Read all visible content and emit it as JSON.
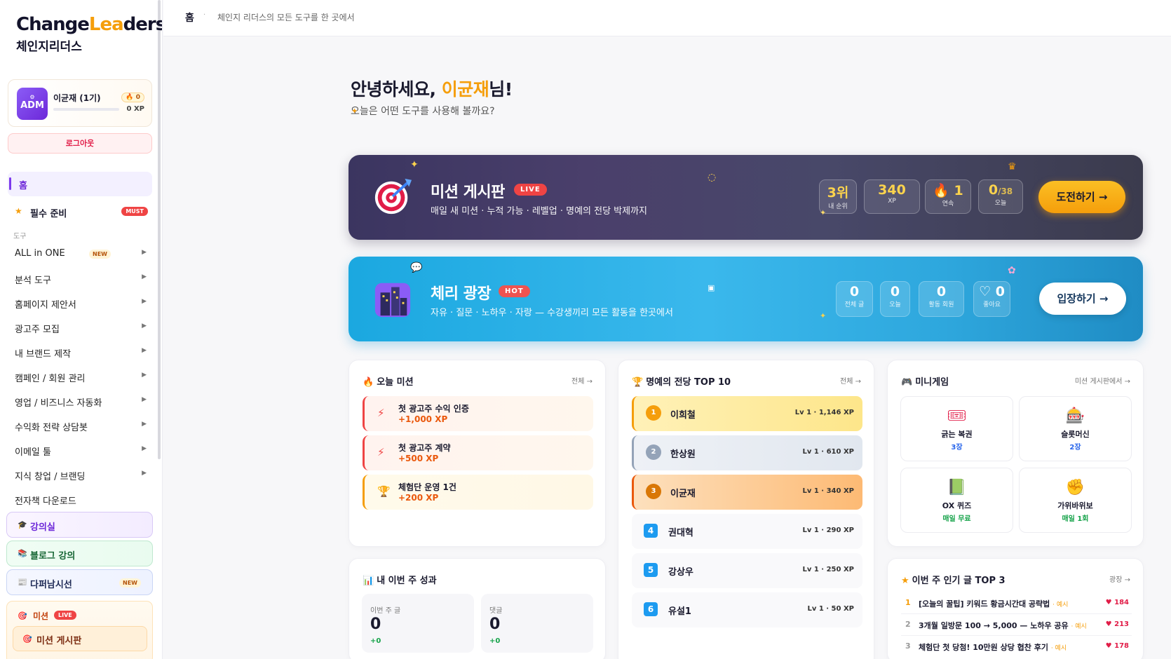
{
  "brand": {
    "logo_en_1": "Change",
    "logo_en_2": "Le",
    "logo_en_3": "a",
    "logo_en_4": "ders",
    "logo_ko": "체인지리더스"
  },
  "profile": {
    "avatar_label": "ADM",
    "name": "이균재 (1기)",
    "fire": "🔥 0",
    "xp": "0 XP",
    "logout": "로그아웃"
  },
  "nav": {
    "home": "홈",
    "must": "필수 준비",
    "must_badge": "MUST",
    "section_tools": "도구",
    "items": [
      {
        "label": "ALL in ONE",
        "badge": "NEW"
      },
      {
        "label": "분석 도구"
      },
      {
        "label": "홈페이지 제안서"
      },
      {
        "label": "광고주 모집"
      },
      {
        "label": "내 브랜드 제작"
      },
      {
        "label": "캠페인 / 회원 관리"
      },
      {
        "label": "영업 / 비즈니스 자동화"
      },
      {
        "label": "수익화 전략 상담봇"
      },
      {
        "label": "이메일 툴"
      },
      {
        "label": "지식 창업 / 브랜딩"
      },
      {
        "label": "전자책 다운로드"
      }
    ],
    "lecture": "강의실",
    "blog": "블로그 강의",
    "news": "다퍼남시선",
    "news_badge": "NEW",
    "mission": "미션",
    "mission_badge": "LIVE",
    "mission_board": "미션 게시판"
  },
  "breadcrumb": {
    "home": "홈",
    "sub": "체인지 리더스의 모든 도구를 한 곳에서"
  },
  "greeting": {
    "prefix": "안녕하세요, ",
    "name": "이균재",
    "suffix": "님!",
    "sub": "오늘은 어떤 도구를 사용해 볼까요?"
  },
  "mission_banner": {
    "title": "미션 게시판",
    "badge": "LIVE",
    "desc": "매일 새 미션 · 누적 가능 · 레벨업 · 명예의 전당 박제까지",
    "stats": [
      {
        "value": "3위",
        "key": "내 순위"
      },
      {
        "value": "340",
        "key": "XP"
      },
      {
        "value": "🔥 1",
        "key": "연속"
      },
      {
        "value": "0",
        "suffix": "/38",
        "key": "오늘"
      }
    ],
    "cta": "도전하기 →"
  },
  "plaza_banner": {
    "title": "체리 광장",
    "badge": "HOT",
    "desc": "자유 · 질문 · 노하우 · 자랑 — 수강생끼리 모든 활동을 한곳에서",
    "stats": [
      {
        "value": "0",
        "key": "전체 글"
      },
      {
        "value": "0",
        "key": "오늘"
      },
      {
        "value": "0",
        "key": "활동 회원"
      },
      {
        "value": "♡ 0",
        "key": "좋아요"
      }
    ],
    "cta": "입장하기 →"
  },
  "today_missions": {
    "title": "오늘 미션",
    "link": "전체 →",
    "items": [
      {
        "title": "첫 광고주 수익 인증",
        "xp": "+1,000 XP"
      },
      {
        "title": "첫 광고주 계약",
        "xp": "+500 XP"
      },
      {
        "title": "체험단 운영 1건",
        "xp": "+200 XP"
      }
    ]
  },
  "hall_of_fame": {
    "title": "명예의 전당 TOP 10",
    "link": "전체 →",
    "items": [
      {
        "rank": "1",
        "name": "이희철",
        "lv": "Lv 1 · 1,146 XP"
      },
      {
        "rank": "2",
        "name": "한상원",
        "lv": "Lv 1 · 610 XP"
      },
      {
        "rank": "3",
        "name": "이균재",
        "lv": "Lv 1 · 340 XP"
      },
      {
        "rank": "4",
        "name": "권대혁",
        "lv": "Lv 1 · 290 XP"
      },
      {
        "rank": "5",
        "name": "강상우",
        "lv": "Lv 1 · 250 XP"
      },
      {
        "rank": "6",
        "name": "유설1",
        "lv": "Lv 1 · 50 XP"
      }
    ]
  },
  "mini_games": {
    "title": "미니게임",
    "link": "미션 게시판에서 →",
    "items": [
      {
        "icon": "ticket-icon",
        "name": "긁는 복권",
        "sub": "3장",
        "color": "#2563eb"
      },
      {
        "icon": "slot-machine-icon",
        "name": "슬롯머신",
        "sub": "2장",
        "color": "#2563eb"
      },
      {
        "icon": "book-icon",
        "name": "OX 퀴즈",
        "sub": "매일 무료",
        "color": "#16a34a"
      },
      {
        "icon": "fist-icon",
        "name": "가위바위보",
        "sub": "매일 1회",
        "color": "#16a34a"
      }
    ]
  },
  "weekly_stats": {
    "title": "내 이번 주 성과",
    "items": [
      {
        "key": "이번 주 글",
        "value": "0",
        "delta": "+0"
      },
      {
        "key": "댓글",
        "value": "0",
        "delta": "+0"
      }
    ]
  },
  "popular": {
    "title": "이번 주 인기 글 TOP 3",
    "link": "광장 →",
    "items": [
      {
        "rank": "1",
        "title": "[오늘의 꿀팁] 키워드 황금시간대 공략법 ",
        "ex": "· 예시",
        "hearts": "♥ 184"
      },
      {
        "rank": "2",
        "title": "3개월 일방문 100 → 5,000 — 노하우 공유 ",
        "ex": "· 예시",
        "hearts": "♥ 213"
      },
      {
        "rank": "3",
        "title": "체험단 첫 당첨! 10만원 상당 협찬 후기 ",
        "ex": "· 예시",
        "hearts": "♥ 178"
      }
    ]
  }
}
